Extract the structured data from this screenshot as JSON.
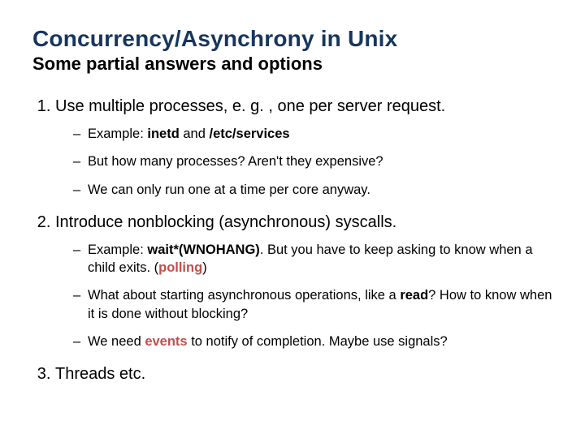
{
  "title": "Concurrency/Asynchrony in Unix",
  "subtitle": "Some partial answers and options",
  "items": [
    {
      "text": "Use multiple processes, e. g. , one per server request.",
      "sub": [
        {
          "prefix": "Example: ",
          "bold": "inetd",
          "mid": " and ",
          "bold2": "/etc/services",
          "suffix": ""
        },
        {
          "plain": "But how many processes?  Aren't they expensive?"
        },
        {
          "plain": "We can only run one at a time per core anyway."
        }
      ]
    },
    {
      "text": "Introduce nonblocking (asynchronous) syscalls.",
      "sub": [
        {
          "prefix": "Example: ",
          "bold": "wait*(WNOHANG)",
          "mid": ".   But you have to keep asking to know when a child exits.  (",
          "accent": "polling",
          "suffix": ")"
        },
        {
          "prefix": "What about starting asynchronous operations, like a ",
          "bold": "read",
          "mid": "?  How to know when it is done without blocking?",
          "suffix": ""
        },
        {
          "prefix": "We need ",
          "accent": "events",
          "mid": " to notify of completion.   Maybe use signals?",
          "suffix": ""
        }
      ]
    },
    {
      "text": "Threads etc.",
      "sub": []
    }
  ]
}
